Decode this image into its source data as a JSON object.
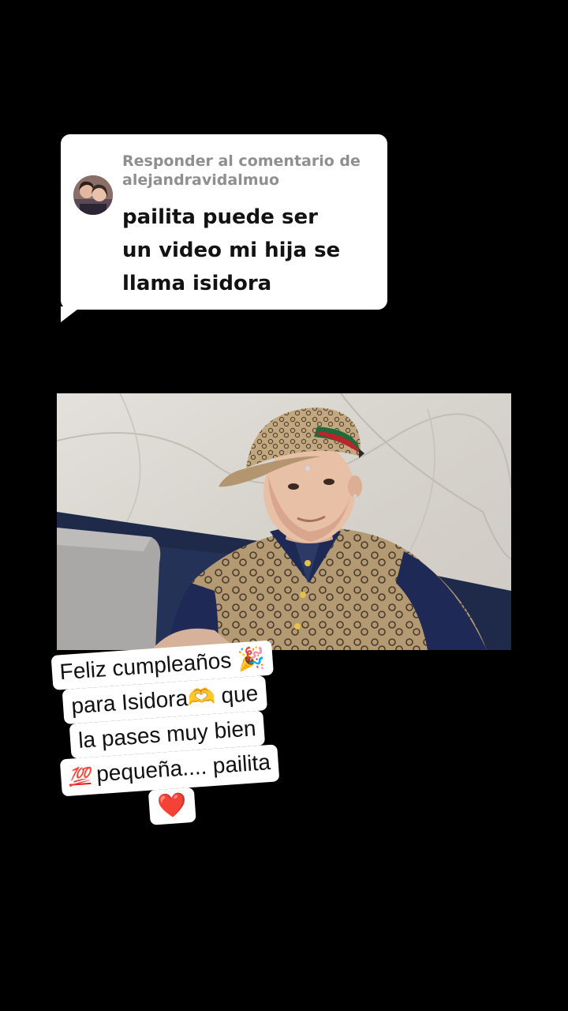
{
  "reply": {
    "header": "Responder al comentario de",
    "username": "alejandravidalmuo",
    "comment": "pailita puede ser\nun video mi hija se\nllama isidora"
  },
  "video": {
    "description": ""
  },
  "caption": {
    "line1": "Feliz cumpleaños",
    "line1_emoji": "🎉",
    "line2": "para Isidora",
    "line2_emoji": "🫶",
    "line2_end": " que",
    "line3": "la pases muy bien",
    "line4_emoji": "💯",
    "line4": " pequeña.... pailita",
    "line5_emoji": "❤️"
  },
  "colors": {
    "background": "#000000",
    "bubble": "#ffffff",
    "header_text": "#8f8f8f",
    "comment_text": "#121212",
    "accent_red": "#e0191e"
  },
  "icons": [
    "avatar",
    "party-popper-icon",
    "heart-hands-icon",
    "hundred-points-icon",
    "red-heart-icon"
  ]
}
